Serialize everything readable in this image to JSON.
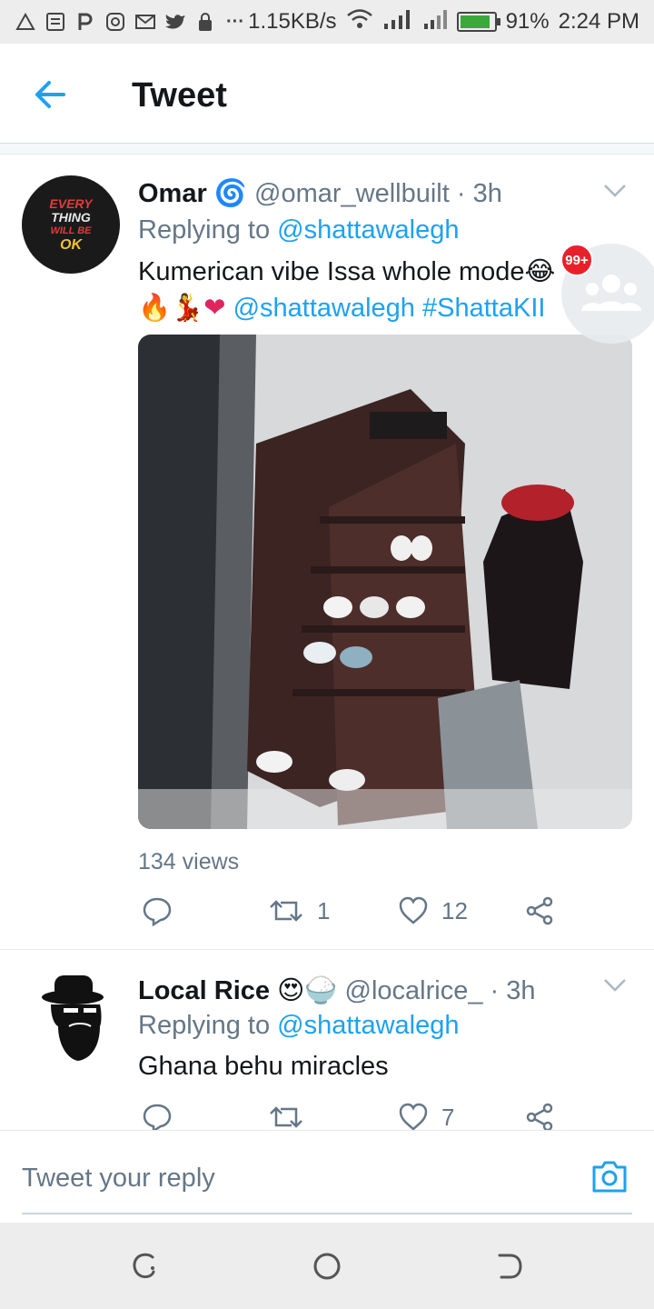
{
  "status_bar": {
    "speed": "1.15KB/s",
    "battery_percent": "91%",
    "battery_level": 0.91,
    "time": "2:24 PM",
    "icons": [
      "alert-triangle-icon",
      "news-icon",
      "p-icon",
      "instagram-icon",
      "gmail-icon",
      "twitter-icon",
      "lock-icon",
      "more-icon",
      "wifi-icon",
      "signal-icon",
      "signal-icon",
      "battery-icon"
    ],
    "more_label": "···"
  },
  "app_bar": {
    "title": "Tweet"
  },
  "tweets": [
    {
      "name": "Omar",
      "handle": "@omar_wellbuilt",
      "time": "· 3h",
      "replying_prefix": "Replying to",
      "replying_to": "@shattawalegh",
      "text_line1": "Kumerican vibe Issa whole mode",
      "text_line2_mention": "@shattawalegh",
      "text_line2_hashtag": "#ShattaKII",
      "avatar_text": [
        "EVERY",
        "THING",
        "WILL BE",
        "OK"
      ],
      "views": "134 views",
      "retweets": "1",
      "likes": "12"
    },
    {
      "name": "Local Rice",
      "handle": "@localrice_",
      "time": "· 3h",
      "replying_prefix": "Replying to",
      "replying_to": "@shattawalegh",
      "text": "Ghana behu miracles",
      "retweets": "",
      "likes": "7"
    }
  ],
  "chat_bubble": {
    "badge": "99+"
  },
  "reply_bar": {
    "placeholder": "Tweet your reply"
  },
  "colors": {
    "accent": "#1da1f2",
    "text": "#14171a",
    "muted": "#657786",
    "badge": "#e8202a"
  }
}
